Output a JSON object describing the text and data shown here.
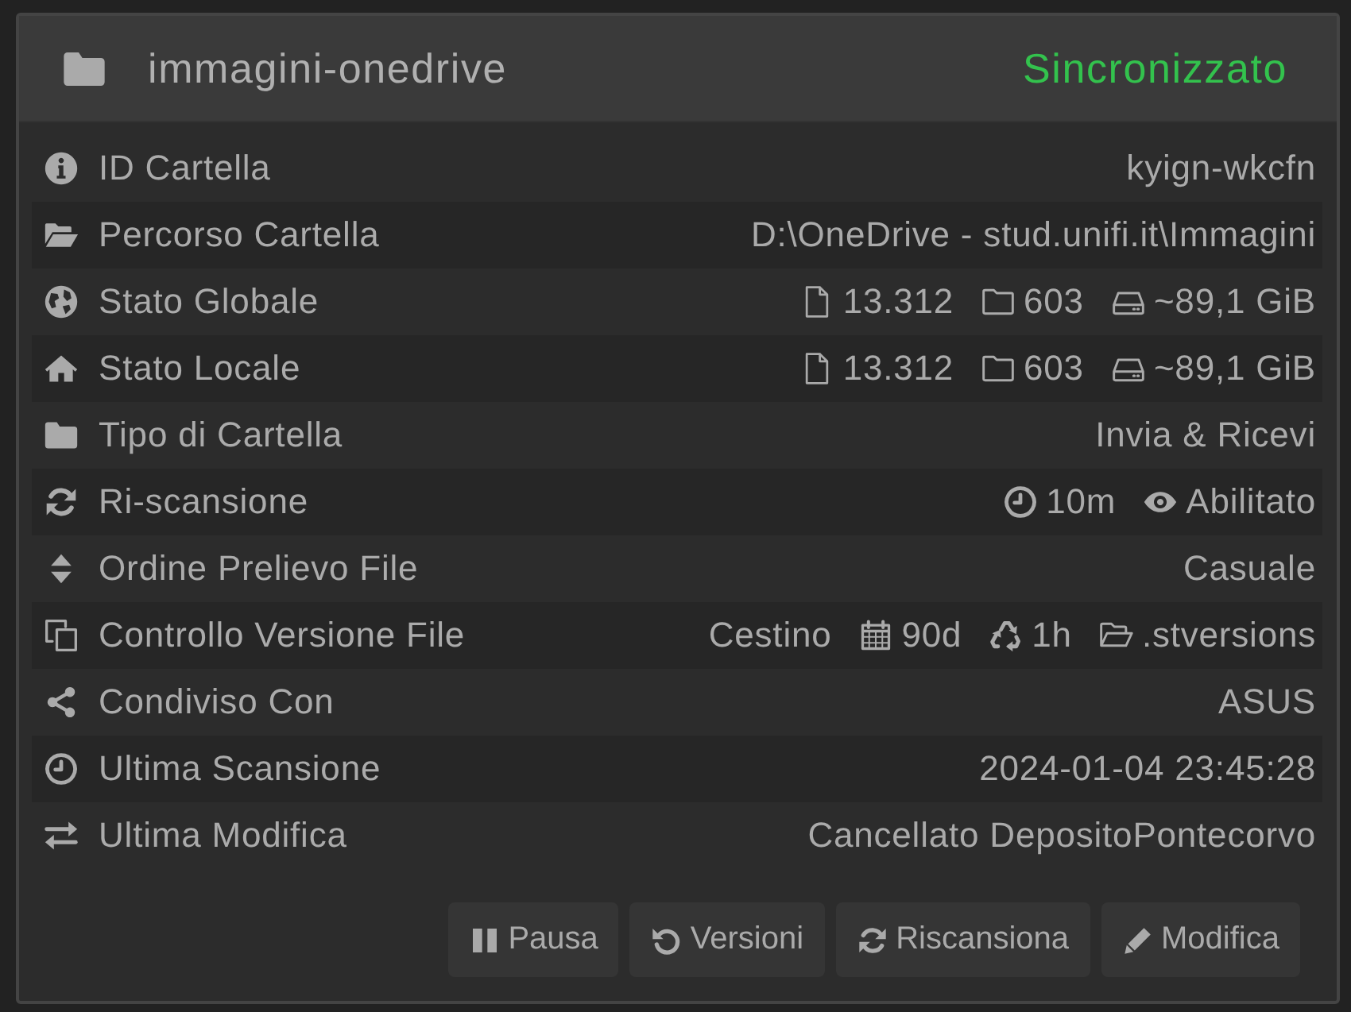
{
  "panel": {
    "title": "immagini-onedrive",
    "status": {
      "label": "Sincronizzato",
      "kind": "synced"
    }
  },
  "rows": [
    {
      "kind": "id",
      "label": "ID Cartella",
      "values": [
        {
          "kind": "text",
          "text": "kyign-wkcfn"
        }
      ]
    },
    {
      "kind": "path",
      "label": "Percorso Cartella",
      "values": [
        {
          "kind": "text",
          "text": "D:\\OneDrive - stud.unifi.it\\Immagini"
        }
      ]
    },
    {
      "kind": "global",
      "label": "Stato Globale",
      "values": [
        {
          "kind": "files",
          "text": "13.312"
        },
        {
          "kind": "folders",
          "text": "603"
        },
        {
          "kind": "size",
          "text": "~89,1 GiB"
        }
      ]
    },
    {
      "kind": "local",
      "label": "Stato Locale",
      "values": [
        {
          "kind": "files",
          "text": "13.312"
        },
        {
          "kind": "folders",
          "text": "603"
        },
        {
          "kind": "size",
          "text": "~89,1 GiB"
        }
      ]
    },
    {
      "kind": "type",
      "label": "Tipo di Cartella",
      "values": [
        {
          "kind": "text",
          "text": "Invia & Ricevi"
        }
      ]
    },
    {
      "kind": "rescan",
      "label": "Ri-scansione",
      "values": [
        {
          "kind": "interval",
          "text": "10m"
        },
        {
          "kind": "watcher",
          "text": "Abilitato"
        }
      ]
    },
    {
      "kind": "order",
      "label": "Ordine Prelievo File",
      "values": [
        {
          "kind": "text",
          "text": "Casuale"
        }
      ]
    },
    {
      "kind": "versioning",
      "label": "Controllo Versione File",
      "values": [
        {
          "kind": "text",
          "text": "Cestino"
        },
        {
          "kind": "age",
          "text": "90d"
        },
        {
          "kind": "cleanup",
          "text": "1h"
        },
        {
          "kind": "versions_path",
          "text": ".stversions"
        }
      ]
    },
    {
      "kind": "shared",
      "label": "Condiviso Con",
      "values": [
        {
          "kind": "text",
          "text": "ASUS"
        }
      ]
    },
    {
      "kind": "last_scan",
      "label": "Ultima Scansione",
      "values": [
        {
          "kind": "text",
          "text": "2024-01-04 23:45:28"
        }
      ]
    },
    {
      "kind": "last_change",
      "label": "Ultima Modifica",
      "values": [
        {
          "kind": "text",
          "text": "Cancellato DepositoPontecorvo"
        }
      ]
    }
  ],
  "buttons": [
    {
      "kind": "pause",
      "label": "Pausa"
    },
    {
      "kind": "versions",
      "label": "Versioni"
    },
    {
      "kind": "rescan",
      "label": "Riscansiona"
    },
    {
      "kind": "edit",
      "label": "Modifica"
    }
  ]
}
